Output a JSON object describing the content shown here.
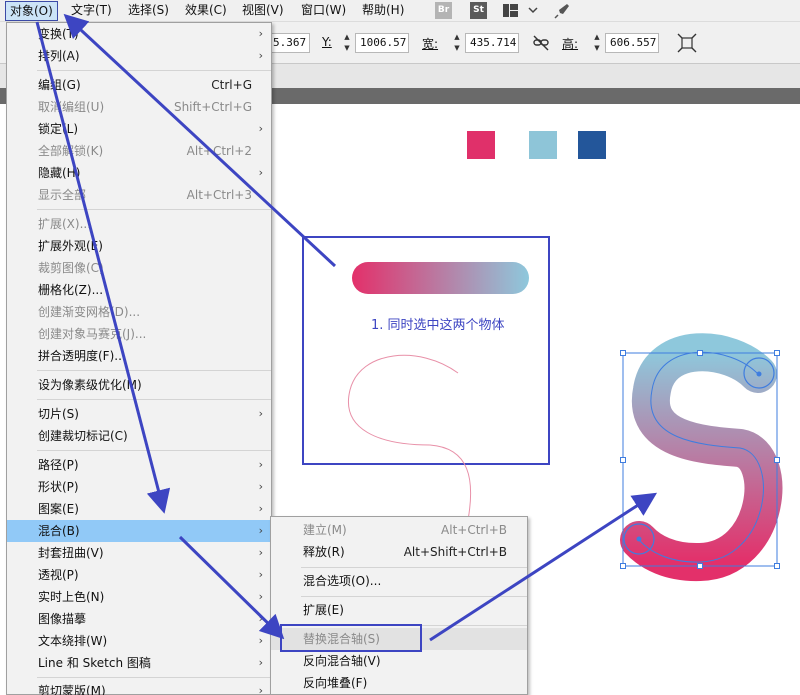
{
  "menubar": {
    "items": [
      "对象(O)",
      "文字(T)",
      "选择(S)",
      "效果(C)",
      "视图(V)",
      "窗口(W)",
      "帮助(H)"
    ],
    "bridge_label": "Br",
    "stock_label": "St"
  },
  "controlbar": {
    "x_value": "5.367",
    "y_label": "Y:",
    "y_value": "1006.57",
    "w_label": "宽:",
    "w_value": "435.714",
    "h_label": "高:",
    "h_value": "606.557"
  },
  "object_menu": {
    "items": [
      {
        "label": "变换(T)",
        "shortcut": "",
        "submenu": true,
        "disabled": false
      },
      {
        "label": "排列(A)",
        "shortcut": "",
        "submenu": true,
        "disabled": false
      },
      {
        "label": "编组(G)",
        "shortcut": "Ctrl+G",
        "submenu": false,
        "disabled": false
      },
      {
        "label": "取消编组(U)",
        "shortcut": "Shift+Ctrl+G",
        "submenu": false,
        "disabled": true
      },
      {
        "label": "锁定(L)",
        "shortcut": "",
        "submenu": true,
        "disabled": false
      },
      {
        "label": "全部解锁(K)",
        "shortcut": "Alt+Ctrl+2",
        "submenu": false,
        "disabled": true
      },
      {
        "label": "隐藏(H)",
        "shortcut": "",
        "submenu": true,
        "disabled": false
      },
      {
        "label": "显示全部",
        "shortcut": "Alt+Ctrl+3",
        "submenu": false,
        "disabled": true
      },
      {
        "label": "扩展(X)...",
        "shortcut": "",
        "submenu": false,
        "disabled": true
      },
      {
        "label": "扩展外观(E)",
        "shortcut": "",
        "submenu": false,
        "disabled": false
      },
      {
        "label": "裁剪图像(C)",
        "shortcut": "",
        "submenu": false,
        "disabled": true
      },
      {
        "label": "栅格化(Z)...",
        "shortcut": "",
        "submenu": false,
        "disabled": false
      },
      {
        "label": "创建渐变网格(D)...",
        "shortcut": "",
        "submenu": false,
        "disabled": true
      },
      {
        "label": "创建对象马赛克(J)...",
        "shortcut": "",
        "submenu": false,
        "disabled": true
      },
      {
        "label": "拼合透明度(F)...",
        "shortcut": "",
        "submenu": false,
        "disabled": false
      },
      {
        "label": "设为像素级优化(M)",
        "shortcut": "",
        "submenu": false,
        "disabled": false
      },
      {
        "label": "切片(S)",
        "shortcut": "",
        "submenu": true,
        "disabled": false
      },
      {
        "label": "创建裁切标记(C)",
        "shortcut": "",
        "submenu": false,
        "disabled": false
      },
      {
        "label": "路径(P)",
        "shortcut": "",
        "submenu": true,
        "disabled": false
      },
      {
        "label": "形状(P)",
        "shortcut": "",
        "submenu": true,
        "disabled": false
      },
      {
        "label": "图案(E)",
        "shortcut": "",
        "submenu": true,
        "disabled": false
      },
      {
        "label": "混合(B)",
        "shortcut": "",
        "submenu": true,
        "disabled": false,
        "highlighted": true
      },
      {
        "label": "封套扭曲(V)",
        "shortcut": "",
        "submenu": true,
        "disabled": false
      },
      {
        "label": "透视(P)",
        "shortcut": "",
        "submenu": true,
        "disabled": false
      },
      {
        "label": "实时上色(N)",
        "shortcut": "",
        "submenu": true,
        "disabled": false
      },
      {
        "label": "图像描摹",
        "shortcut": "",
        "submenu": true,
        "disabled": false
      },
      {
        "label": "文本绕排(W)",
        "shortcut": "",
        "submenu": true,
        "disabled": false
      },
      {
        "label": "Line 和 Sketch 图稿",
        "shortcut": "",
        "submenu": true,
        "disabled": false
      },
      {
        "label": "剪切蒙版(M)",
        "shortcut": "",
        "submenu": true,
        "disabled": false
      }
    ]
  },
  "blend_submenu": {
    "items": [
      {
        "label": "建立(M)",
        "shortcut": "Alt+Ctrl+B",
        "disabled": true
      },
      {
        "label": "释放(R)",
        "shortcut": "Alt+Shift+Ctrl+B",
        "disabled": false
      },
      {
        "label": "混合选项(O)...",
        "shortcut": "",
        "disabled": false
      },
      {
        "label": "扩展(E)",
        "shortcut": "",
        "disabled": false
      },
      {
        "label": "替换混合轴(S)",
        "shortcut": "",
        "disabled": true,
        "hovered": true
      },
      {
        "label": "反向混合轴(V)",
        "shortcut": "",
        "disabled": false
      },
      {
        "label": "反向堆叠(F)",
        "shortcut": "",
        "disabled": false
      }
    ]
  },
  "canvas": {
    "caption": "1. 同时选中这两个物体",
    "swatch_colors": [
      "#e0306a",
      "#8ec5d8",
      "#23569a"
    ],
    "gradient_start": "#e3306a",
    "gradient_end": "#8ec8dc",
    "annotation_color": "#3d45c2"
  }
}
